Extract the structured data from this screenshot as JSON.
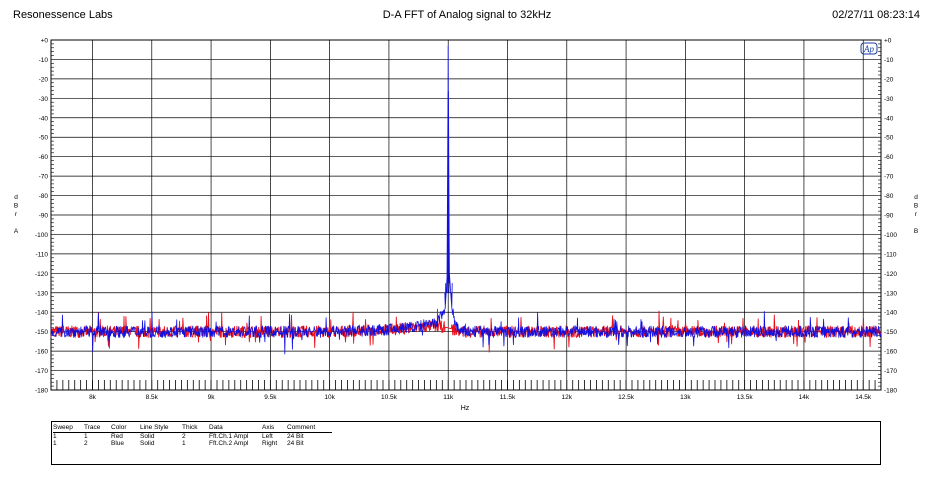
{
  "header": {
    "left": "Resonessence Labs",
    "center": "D-A FFT of Analog signal to 32kHz",
    "right": "02/27/11 08:23:14"
  },
  "logo_text": "Ap",
  "chart_data": {
    "type": "line",
    "title": "D-A FFT of Analog signal to 32kHz",
    "xlabel": "Hz",
    "ylabel_left": [
      "d",
      "B",
      "r",
      "",
      "A"
    ],
    "ylabel_right": [
      "d",
      "B",
      "r",
      "",
      "B"
    ],
    "xlim": [
      7650,
      14650
    ],
    "ylim": [
      -180,
      0
    ],
    "x_ticks": [
      {
        "value": 8000,
        "label": "8k"
      },
      {
        "value": 8500,
        "label": "8.5k"
      },
      {
        "value": 9000,
        "label": "9k"
      },
      {
        "value": 9500,
        "label": "9.5k"
      },
      {
        "value": 10000,
        "label": "10k"
      },
      {
        "value": 10500,
        "label": "10.5k"
      },
      {
        "value": 11000,
        "label": "11k"
      },
      {
        "value": 11500,
        "label": "11.5k"
      },
      {
        "value": 12000,
        "label": "12k"
      },
      {
        "value": 12500,
        "label": "12.5k"
      },
      {
        "value": 13000,
        "label": "13k"
      },
      {
        "value": 13500,
        "label": "13.5k"
      },
      {
        "value": 14000,
        "label": "14k"
      },
      {
        "value": 14500,
        "label": "14.5k"
      }
    ],
    "y_ticks_left": [
      "+0",
      "-10",
      "-20",
      "-30",
      "-40",
      "-50",
      "-60",
      "-70",
      "-80",
      "-90",
      "-100",
      "-110",
      "-120",
      "-130",
      "-140",
      "-150",
      "-160",
      "-170",
      "-180"
    ],
    "y_ticks_right": [
      "+0",
      "-10",
      "-20",
      "-30",
      "-40",
      "-50",
      "-60",
      "-70",
      "-80",
      "-90",
      "-100",
      "-110",
      "-120",
      "-130",
      "-140",
      "-150",
      "-160",
      "-170",
      "-180"
    ],
    "grid": true,
    "series": [
      {
        "name": "Fft.Ch.1 Ampl",
        "color": "#e8101c",
        "axis": "Left",
        "noise_floor_db": -150,
        "points": [
          [
            7650,
            -150
          ],
          [
            8000,
            -150
          ],
          [
            8500,
            -150
          ],
          [
            9000,
            -150
          ],
          [
            9500,
            -150
          ],
          [
            10000,
            -150
          ],
          [
            10500,
            -149
          ],
          [
            10900,
            -147
          ],
          [
            11000,
            -148
          ],
          [
            11100,
            -150
          ],
          [
            11500,
            -150
          ],
          [
            12000,
            -150
          ],
          [
            12500,
            -150
          ],
          [
            13000,
            -150
          ],
          [
            13500,
            -150
          ],
          [
            14000,
            -150
          ],
          [
            14650,
            -150
          ]
        ]
      },
      {
        "name": "Fft.Ch.2 Ampl",
        "color": "#1010e0",
        "axis": "Right",
        "noise_floor_db": -150,
        "points": [
          [
            7650,
            -150
          ],
          [
            8000,
            -150
          ],
          [
            8500,
            -150
          ],
          [
            9000,
            -150
          ],
          [
            9500,
            -150
          ],
          [
            10000,
            -150
          ],
          [
            10500,
            -149
          ],
          [
            10900,
            -146
          ],
          [
            10975,
            -138
          ],
          [
            10990,
            -122
          ],
          [
            11000,
            -3
          ],
          [
            11010,
            -120
          ],
          [
            11030,
            -138
          ],
          [
            11060,
            -146
          ],
          [
            11100,
            -150
          ],
          [
            11500,
            -150
          ],
          [
            12000,
            -150
          ],
          [
            12500,
            -150
          ],
          [
            13000,
            -150
          ],
          [
            13500,
            -150
          ],
          [
            14000,
            -150
          ],
          [
            14650,
            -150
          ]
        ]
      }
    ]
  },
  "legend": {
    "headers": [
      "Sweep",
      "Trace",
      "Color",
      "Line Style",
      "Thick",
      "Data",
      "Axis",
      "Comment"
    ],
    "rows": [
      [
        "1",
        "1",
        "Red",
        "Solid",
        "2",
        "Fft.Ch.1 Ampl",
        "Left",
        "24 Bit"
      ],
      [
        "1",
        "2",
        "Blue",
        "Solid",
        "1",
        "Fft.Ch.2 Ampl",
        "Right",
        "24 Bit"
      ]
    ]
  }
}
